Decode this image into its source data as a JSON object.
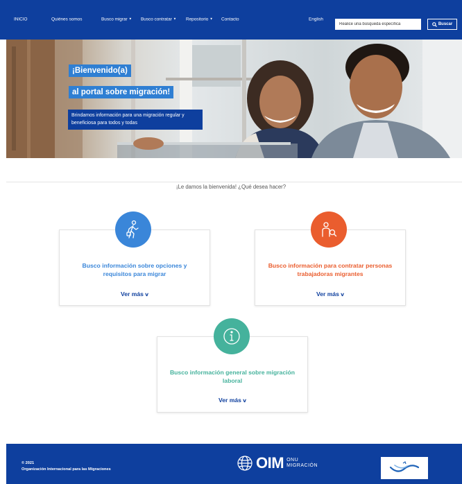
{
  "nav": {
    "home": "INICIO",
    "quienes": "Quiénes somos",
    "busco_migrar": "Busco migrar",
    "busco_contratar": "Busco contratar",
    "repositorio": "Repositorio",
    "contacto": "Contacto",
    "language": "English",
    "search_placeholder": "Realice una búsqueda específica",
    "search_button": "Buscar"
  },
  "hero": {
    "title_line1": "¡Bienvenido(a)",
    "title_line2": "al portal sobre migración!",
    "subtitle": "Brindamos información para una migración regular y beneficiosa para todos y todas"
  },
  "welcome_question": "¡Le damos la bienvenida! ¿Qué desea hacer?",
  "cards": [
    {
      "text": "Busco información sobre opciones y requisitos para migrar",
      "link": "Ver más",
      "icon": "walking-person-icon",
      "color": "#3a86d9"
    },
    {
      "text": "Busco información para contratar personas trabajadoras migrantes",
      "link": "Ver más",
      "icon": "person-search-icon",
      "color": "#ea5d2e"
    },
    {
      "text": "Busco información general sobre migración laboral",
      "link": "Ver más",
      "icon": "info-icon",
      "color": "#45b29c"
    }
  ],
  "footer": {
    "year": "© 2021",
    "org": "Organización Internacional para las Migraciones",
    "logo_main": "OIM",
    "logo_sub1": "ONU",
    "logo_sub2": "MIGRACIÓN"
  },
  "colors": {
    "brand_blue": "#0e3f9e",
    "accent_blue": "#2f7fd3"
  }
}
